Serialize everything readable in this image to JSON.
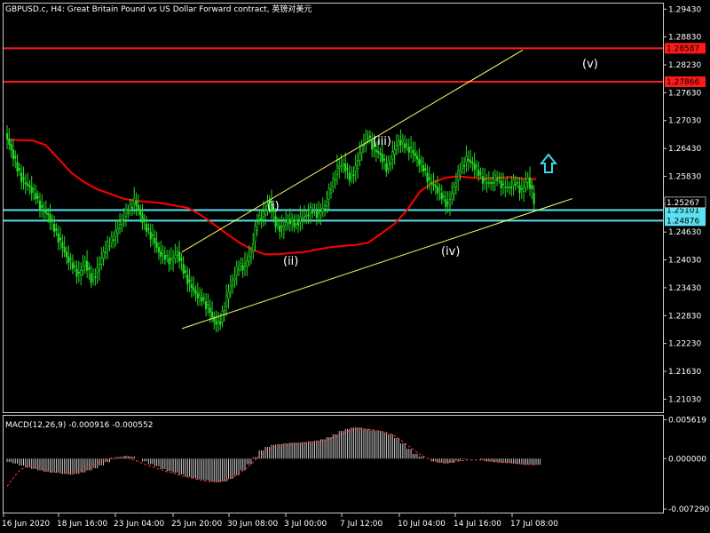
{
  "window": {
    "title": "GBPUSD.c, H4:  Great Britain Pound vs US Dollar Forward contract, 英镑对美元"
  },
  "colors": {
    "background": "#000000",
    "candles": "#22dd22",
    "ma": "#ff0000",
    "channel": "#ffff66",
    "resistance": "#ff1a1a",
    "support": "#5ce1f0",
    "macd_hist": "#cccccc",
    "macd_signal": "#ff3333",
    "arrow": "#3cd7e6",
    "frame": "#cccccc"
  },
  "chart_data": [
    {
      "type": "candlestick",
      "title": "GBPUSD.c, H4:  Great Britain Pound vs US Dollar Forward contract, 英镑对美元",
      "y_ticks": [
        "1.29430",
        "1.28830",
        "1.28230",
        "1.27630",
        "1.27030",
        "1.26430",
        "1.25830",
        "1.25230",
        "1.24630",
        "1.24030",
        "1.23430",
        "1.22830",
        "1.22230",
        "1.21630",
        "1.21030"
      ],
      "y_tick_values": [
        1.2943,
        1.2883,
        1.2823,
        1.2763,
        1.2703,
        1.2643,
        1.2583,
        1.2523,
        1.2463,
        1.2403,
        1.2343,
        1.2283,
        1.2223,
        1.2163,
        1.2103
      ],
      "ylim": [
        1.2075,
        1.2955
      ],
      "x_ticks": [
        "16 Jun 2020",
        "18 Jun 16:00",
        "23 Jun 04:00",
        "25 Jun 20:00",
        "30 Jun 08:00",
        "3 Jul 00:00",
        "7 Jul 12:00",
        "10 Jul 04:00",
        "14 Jul 16:00",
        "17 Jul 08:00"
      ],
      "price_close": [
        1.2675,
        1.264,
        1.26,
        1.257,
        1.256,
        1.254,
        1.251,
        1.25,
        1.247,
        1.244,
        1.241,
        1.239,
        1.237,
        1.24,
        1.236,
        1.238,
        1.242,
        1.244,
        1.246,
        1.249,
        1.251,
        1.253,
        1.25,
        1.247,
        1.245,
        1.242,
        1.241,
        1.24,
        1.242,
        1.238,
        1.235,
        1.233,
        1.232,
        1.23,
        1.227,
        1.227,
        1.232,
        1.236,
        1.239,
        1.239,
        1.242,
        1.249,
        1.25,
        1.253,
        1.248,
        1.247,
        1.249,
        1.248,
        1.249,
        1.25,
        1.251,
        1.25,
        1.252,
        1.256,
        1.26,
        1.261,
        1.258,
        1.26,
        1.265,
        1.267,
        1.264,
        1.263,
        1.26,
        1.263,
        1.266,
        1.265,
        1.264,
        1.262,
        1.26,
        1.257,
        1.256,
        1.254,
        1.252,
        1.256,
        1.26,
        1.262,
        1.261,
        1.259,
        1.257,
        1.257,
        1.258,
        1.256,
        1.256,
        1.257,
        1.255,
        1.258,
        1.253
      ],
      "moving_average": [
        1.2662,
        1.2661,
        1.266,
        1.265,
        1.262,
        1.259,
        1.257,
        1.2555,
        1.2545,
        1.2535,
        1.253,
        1.2528,
        1.2525,
        1.252,
        1.2515,
        1.25,
        1.248,
        1.246,
        1.244,
        1.2425,
        1.2415,
        1.2415,
        1.2418,
        1.242,
        1.2425,
        1.243,
        1.2433,
        1.2435,
        1.244,
        1.246,
        1.248,
        1.251,
        1.255,
        1.257,
        1.258,
        1.2583,
        1.258,
        1.2578,
        1.258,
        1.2581,
        1.2578,
        1.2577
      ],
      "channel": {
        "upper": [
          {
            "x": "25 Jun 20:00",
            "y": 1.242
          },
          {
            "x": "17 Jul 08:00",
            "y": 1.2855
          }
        ],
        "lower": [
          {
            "x": "25 Jun 20:00",
            "y": 1.2255
          },
          {
            "x": "17 Jul 08:00",
            "y": 1.2535
          }
        ]
      },
      "horizontal_lines": [
        {
          "value": 1.28587,
          "label": "1.28587",
          "kind": "resistance"
        },
        {
          "value": 1.27866,
          "label": "1.27866",
          "kind": "resistance"
        },
        {
          "value": 1.25101,
          "label": "1.25101",
          "kind": "support"
        },
        {
          "value": 1.24876,
          "label": "1.24876",
          "kind": "support"
        }
      ],
      "current_price": {
        "value": 1.25267,
        "label": "1.25267"
      },
      "wave_labels": [
        "(i)",
        "(ii)",
        "(iii)",
        "(iv)",
        "(v)"
      ],
      "annotations": [
        "up-arrow"
      ]
    },
    {
      "type": "histogram",
      "title": "MACD(12,26,9) -0.000916 -0.000552",
      "y_ticks": [
        "0.005619",
        "0.000000",
        "-0.007290"
      ],
      "y_tick_values": [
        0.005619,
        0.0,
        -0.00729
      ],
      "ylim": [
        -0.0078,
        0.0062
      ],
      "histogram": [
        -0.0005,
        -0.0007,
        -0.001,
        -0.0013,
        -0.0015,
        -0.0017,
        -0.0019,
        -0.002,
        -0.002,
        -0.0022,
        -0.0023,
        -0.0022,
        -0.002,
        -0.0017,
        -0.0014,
        -0.001,
        -0.0005,
        -0.0001,
        0.0002,
        0.0004,
        0.0003,
        0.0,
        -0.0004,
        -0.0008,
        -0.0011,
        -0.0015,
        -0.0018,
        -0.002,
        -0.0023,
        -0.0026,
        -0.0028,
        -0.003,
        -0.0031,
        -0.0033,
        -0.0034,
        -0.0033,
        -0.0029,
        -0.0024,
        -0.0017,
        -0.0008,
        0.0002,
        0.0012,
        0.0017,
        0.002,
        0.0021,
        0.0022,
        0.0023,
        0.0023,
        0.0024,
        0.0025,
        0.0026,
        0.0028,
        0.0031,
        0.0035,
        0.004,
        0.0043,
        0.0045,
        0.0045,
        0.0043,
        0.0041,
        0.004,
        0.0038,
        0.0035,
        0.003,
        0.0022,
        0.0014,
        0.0007,
        0.0003,
        0.0,
        -0.0004,
        -0.0006,
        -0.0007,
        -0.0006,
        -0.0003,
        -0.0001,
        0.0,
        0.0,
        -0.0002,
        -0.0004,
        -0.0005,
        -0.0006,
        -0.0006,
        -0.0007,
        -0.0008,
        -0.0009,
        -0.0009,
        -0.0009
      ],
      "signal": [
        -0.004,
        -0.0028,
        -0.0017,
        -0.0012,
        -0.001,
        -0.0012,
        -0.0016,
        -0.0019,
        -0.002,
        -0.0021,
        -0.0021,
        -0.0019,
        -0.0017,
        -0.0013,
        -0.0009,
        -0.0005,
        -0.0002,
        0.0001,
        0.0002,
        0.0002,
        0.0,
        -0.0003,
        -0.0007,
        -0.001,
        -0.0013,
        -0.0016,
        -0.0019,
        -0.0021,
        -0.0024,
        -0.0026,
        -0.0028,
        -0.003,
        -0.0032,
        -0.0033,
        -0.0033,
        -0.0032,
        -0.003,
        -0.0026,
        -0.002,
        -0.0013,
        -0.0005,
        0.0004,
        0.001,
        0.0014,
        0.0017,
        0.0019,
        0.002,
        0.0021,
        0.0022,
        0.0023,
        0.0024,
        0.0025,
        0.0027,
        0.003,
        0.0034,
        0.0038,
        0.0041,
        0.0043,
        0.0043,
        0.0042,
        0.0041,
        0.0039,
        0.0037,
        0.0033,
        0.0027,
        0.002,
        0.0013,
        0.0007,
        0.0002,
        -0.0002,
        -0.0004,
        -0.0005,
        -0.0005,
        -0.0004,
        -0.0003,
        -0.0002,
        -0.0002,
        -0.0002,
        -0.0003,
        -0.0004,
        -0.0005,
        -0.0006,
        -0.0006,
        -0.0007,
        -0.0008,
        -0.0008,
        -0.0009
      ]
    }
  ]
}
